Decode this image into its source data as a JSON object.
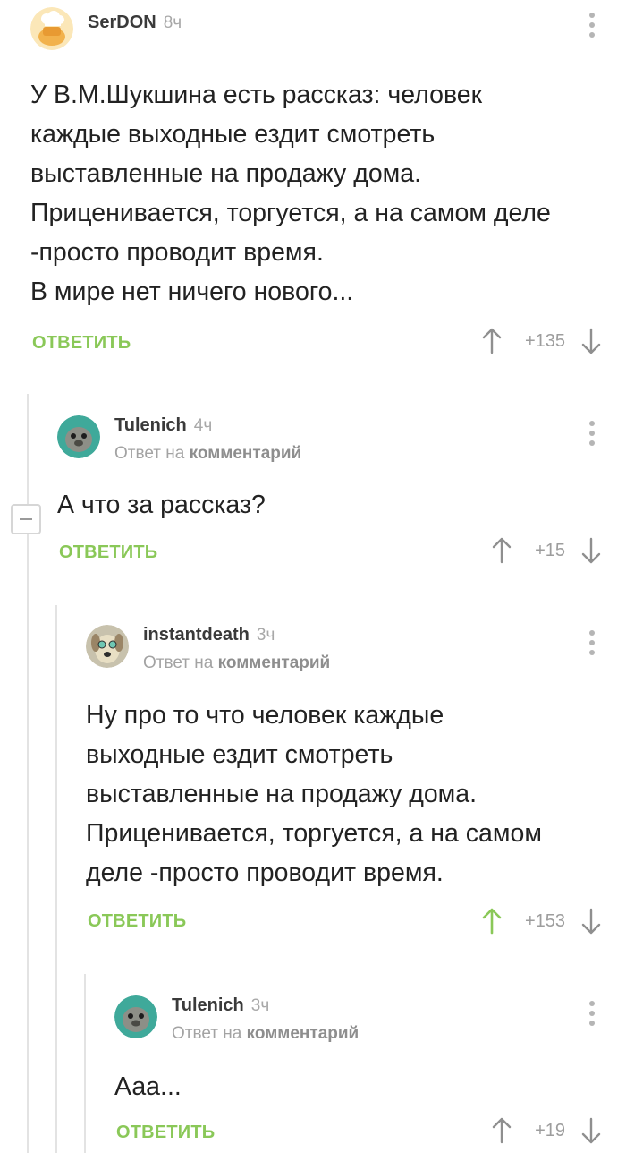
{
  "comments": [
    {
      "author": "SerDON",
      "time": "8ч",
      "reply_to": null,
      "text": "У В.М.Шукшина есть рассказ: человек\nкаждые выходные ездит смотреть\nвыставленные на продажу дома.\nПриценивается, торгуется, а на самом деле\n-просто проводит время.\nВ мире нет ничего нового...",
      "reply_label": "ОТВЕТИТЬ",
      "rating": "+135",
      "upvoted": false
    },
    {
      "author": "Tulenich",
      "time": "4ч",
      "reply_to_prefix": "Ответ на",
      "reply_to_link": "комментарий",
      "text": "А что за рассказ?",
      "reply_label": "ОТВЕТИТЬ",
      "rating": "+15",
      "upvoted": false
    },
    {
      "author": "instantdeath",
      "time": "3ч",
      "reply_to_prefix": "Ответ на",
      "reply_to_link": "комментарий",
      "text": "Ну про то что человек каждые\nвыходные ездит смотреть\nвыставленные на продажу дома.\nПриценивается, торгуется, а на самом\nделе -просто проводит время.",
      "reply_label": "ОТВЕТИТЬ",
      "rating": "+153",
      "upvoted": true
    },
    {
      "author": "Tulenich",
      "time": "3ч",
      "reply_to_prefix": "Ответ на",
      "reply_to_link": "комментарий",
      "text": "Ааа...",
      "reply_label": "ОТВЕТИТЬ",
      "rating": "+19",
      "upvoted": false
    }
  ],
  "colors": {
    "accent_green": "#8ac858",
    "muted_gray": "#9d9d9d",
    "thread_line": "#e3e3e3"
  },
  "icons": {
    "menu": "vertical-dots-icon",
    "upvote": "arrow-up-icon",
    "downvote": "arrow-down-icon",
    "collapse": "minus-box-icon"
  }
}
